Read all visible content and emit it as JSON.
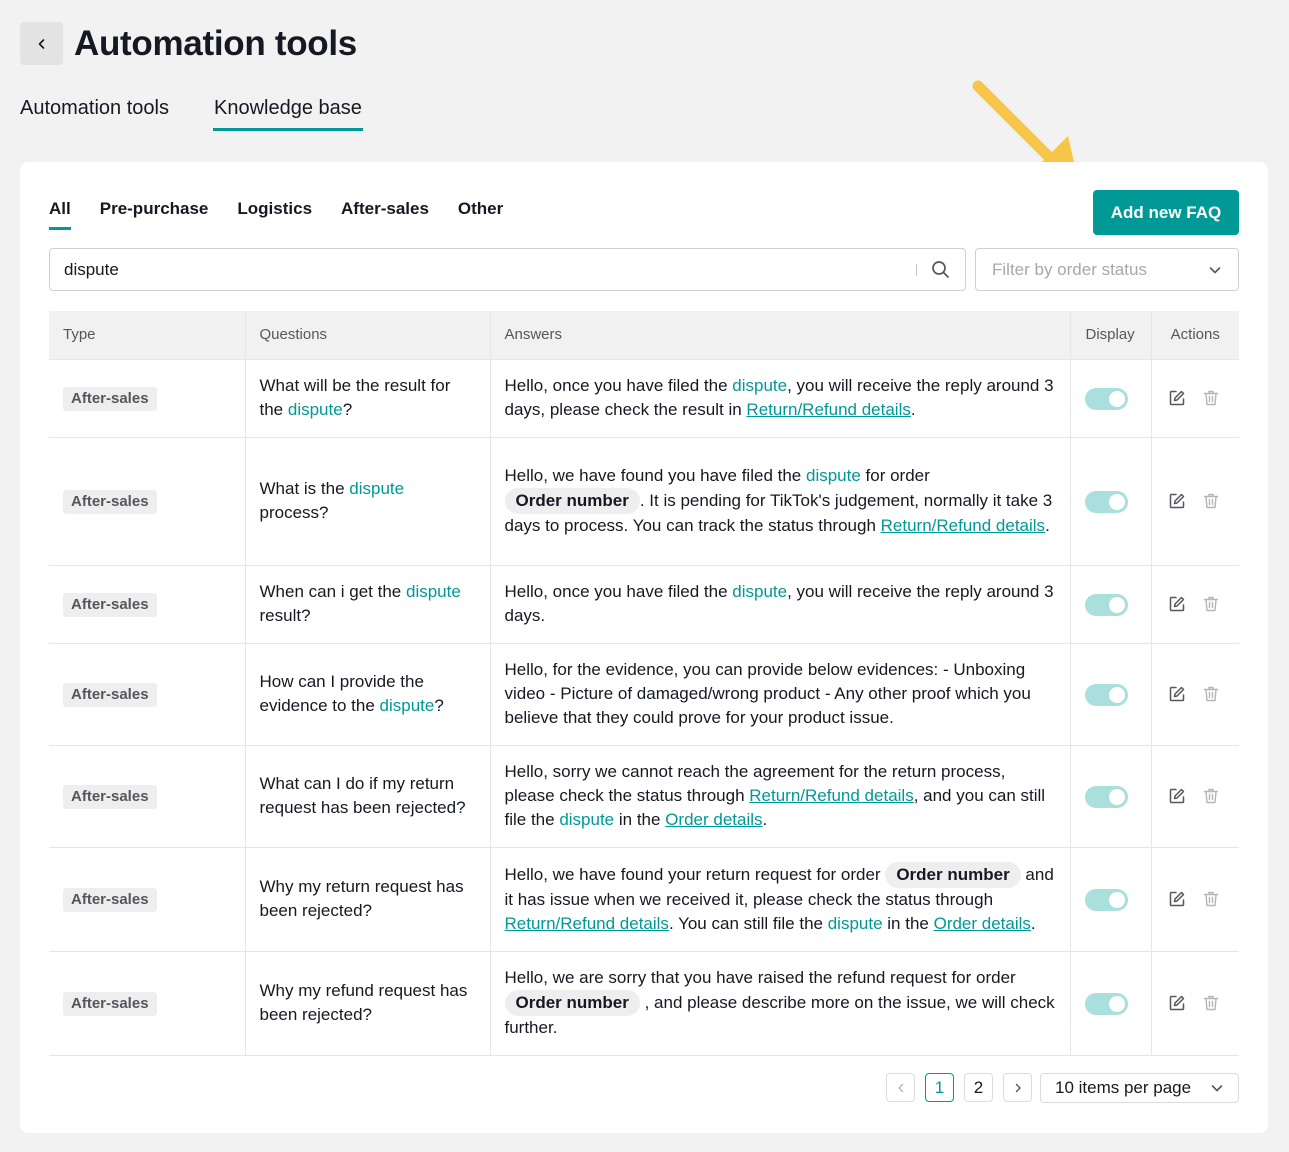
{
  "header": {
    "back_icon": "chevron-left-icon",
    "title": "Automation tools"
  },
  "top_tabs": [
    {
      "label": "Automation tools",
      "active": false
    },
    {
      "label": "Knowledge base",
      "active": true
    }
  ],
  "category_tabs": [
    {
      "label": "All",
      "active": true
    },
    {
      "label": "Pre-purchase",
      "active": false
    },
    {
      "label": "Logistics",
      "active": false
    },
    {
      "label": "After-sales",
      "active": false
    },
    {
      "label": "Other",
      "active": false
    }
  ],
  "add_button_label": "Add new FAQ",
  "search": {
    "value": "dispute",
    "icon": "search-icon"
  },
  "filter": {
    "placeholder": "Filter by order status",
    "icon": "chevron-down-icon"
  },
  "table": {
    "headers": [
      "Type",
      "Questions",
      "Answers",
      "Display",
      "Actions"
    ],
    "rows": [
      {
        "type": "After-sales",
        "question": [
          {
            "t": "What will be the result for the "
          },
          {
            "t": "dispute",
            "k": "kw"
          },
          {
            "t": "?"
          }
        ],
        "answer": [
          {
            "t": "Hello, once you have filed the "
          },
          {
            "t": "dispute",
            "k": "kw"
          },
          {
            "t": ", you will receive the reply around 3 days, please check the result in "
          },
          {
            "t": "Return/Refund details",
            "k": "link"
          },
          {
            "t": "."
          }
        ],
        "display": true
      },
      {
        "type": "After-sales",
        "question": [
          {
            "t": "What is the "
          },
          {
            "t": "dispute",
            "k": "kw"
          },
          {
            "t": " process?"
          }
        ],
        "answer": [
          {
            "t": "Hello, we have found you have filed the "
          },
          {
            "t": "dispute",
            "k": "kw"
          },
          {
            "t": " for order "
          },
          {
            "t": "Order number",
            "k": "chip"
          },
          {
            "t": ". It is pending for TikTok's judgement, normally it take 3 days to process. You can track the status through "
          },
          {
            "t": "Return/Refund details",
            "k": "link"
          },
          {
            "t": "."
          }
        ],
        "display": true
      },
      {
        "type": "After-sales",
        "question": [
          {
            "t": "When can i get the "
          },
          {
            "t": "dispute",
            "k": "kw"
          },
          {
            "t": " result?"
          }
        ],
        "answer": [
          {
            "t": "Hello, once you have filed the "
          },
          {
            "t": "dispute",
            "k": "kw"
          },
          {
            "t": ", you will receive the reply around 3 days."
          }
        ],
        "display": true
      },
      {
        "type": "After-sales",
        "question": [
          {
            "t": "How can I provide the evidence to the "
          },
          {
            "t": "dispute",
            "k": "kw"
          },
          {
            "t": "?"
          }
        ],
        "answer": [
          {
            "t": "Hello, for the evidence, you can provide below evidences: - Unboxing video - Picture of damaged/wrong product - Any other proof which you believe that they could prove for your product issue."
          }
        ],
        "display": true
      },
      {
        "type": "After-sales",
        "question": [
          {
            "t": "What can I do if my return request has been rejected?"
          }
        ],
        "answer": [
          {
            "t": "Hello, sorry we cannot reach the agreement for the return process, please check the status through "
          },
          {
            "t": "Return/Refund details",
            "k": "link"
          },
          {
            "t": ", and you can still file the "
          },
          {
            "t": "dispute",
            "k": "kw"
          },
          {
            "t": " in the "
          },
          {
            "t": "Order details",
            "k": "link"
          },
          {
            "t": "."
          }
        ],
        "display": true
      },
      {
        "type": "After-sales",
        "question": [
          {
            "t": "Why my return request has been rejected?"
          }
        ],
        "answer": [
          {
            "t": "Hello, we have found your return request for order "
          },
          {
            "t": "Order number",
            "k": "chip"
          },
          {
            "t": " and it has issue when we received it, please check the status through "
          },
          {
            "t": "Return/Refund details",
            "k": "link"
          },
          {
            "t": ". You can still file the "
          },
          {
            "t": "dispute",
            "k": "kw"
          },
          {
            "t": " in the "
          },
          {
            "t": "Order details",
            "k": "link"
          },
          {
            "t": "."
          }
        ],
        "display": true
      },
      {
        "type": "After-sales",
        "question": [
          {
            "t": "Why my refund request has been rejected?"
          }
        ],
        "answer": [
          {
            "t": "Hello, we are sorry that you have raised the refund request for order "
          },
          {
            "t": "Order number",
            "k": "chip"
          },
          {
            "t": " , and please describe more on the issue, we will check further."
          }
        ],
        "display": true
      }
    ],
    "action_icons": [
      "edit-icon",
      "trash-icon"
    ]
  },
  "pagination": {
    "pages": [
      "1",
      "2"
    ],
    "current": "1",
    "per_page": "10 items per page"
  },
  "colors": {
    "accent": "#009995",
    "toggle_on": "#a9e0dd",
    "arrow": "#f7c548"
  }
}
